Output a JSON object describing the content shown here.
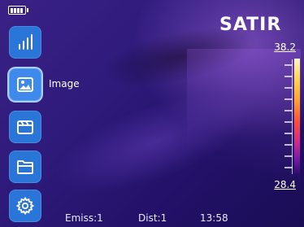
{
  "brand": "SATIR",
  "battery": {
    "level": 1.0
  },
  "sidebar": {
    "items": [
      {
        "name": "analysis",
        "icon": "bar-chart-icon",
        "active": false
      },
      {
        "name": "image",
        "icon": "image-icon",
        "active": true
      },
      {
        "name": "video",
        "icon": "clapperboard-icon",
        "active": false
      },
      {
        "name": "files",
        "icon": "folder-icon",
        "active": false
      },
      {
        "name": "settings",
        "icon": "gear-icon",
        "active": false
      }
    ],
    "active_label": "Image"
  },
  "scale": {
    "max": "38.2",
    "min": "28.4"
  },
  "status": {
    "emissivity": "Emiss:1",
    "distance": "Dist:1",
    "time": "13:58"
  },
  "colors": {
    "button": "#2a76d8",
    "button_active": "#3d8aec"
  }
}
